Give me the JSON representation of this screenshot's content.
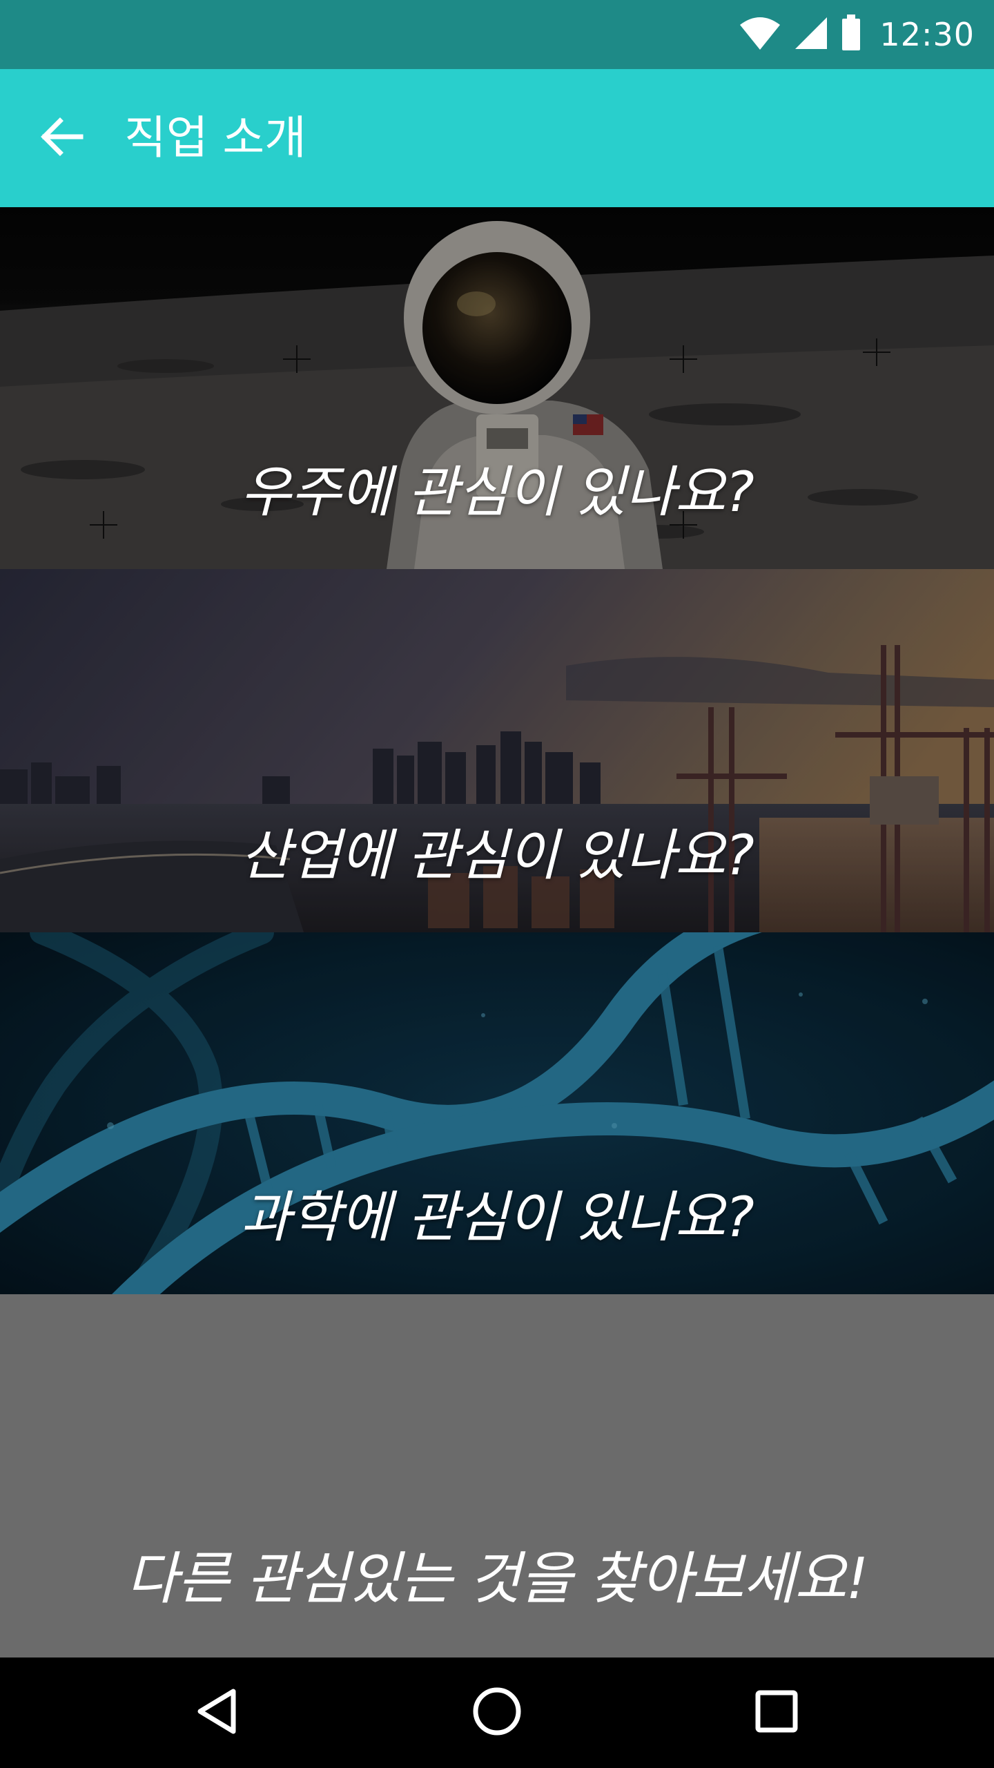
{
  "status_bar": {
    "time": "12:30",
    "icons": [
      "wifi-icon",
      "cellular-signal-icon",
      "battery-icon"
    ],
    "background": "#1e8a87"
  },
  "app_bar": {
    "title": "직업 소개",
    "back_icon": "arrow-left-icon",
    "background": "#29cfcc"
  },
  "categories": [
    {
      "label": "우주에 관심이 있나요?",
      "image": "astronaut-on-moon"
    },
    {
      "label": "산업에 관심이 있나요?",
      "image": "industrial-port-at-dusk"
    },
    {
      "label": "과학에 관심이 있나요?",
      "image": "dna-double-helix"
    },
    {
      "label": "다른 관심있는 것을 찾아보세요!",
      "image": "",
      "background": "#6b6b6b"
    }
  ],
  "nav_bar": {
    "icons": [
      "back-triangle-icon",
      "home-circle-icon",
      "recents-square-icon"
    ]
  }
}
